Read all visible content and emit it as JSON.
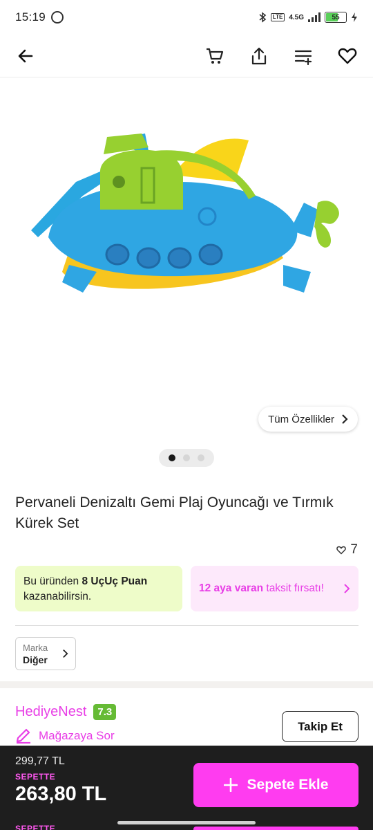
{
  "status_bar": {
    "time": "15:19",
    "network": "4.5G",
    "battery": "55",
    "icons": [
      "whatsapp-icon",
      "bluetooth-icon",
      "volte-icon",
      "signal-icon",
      "battery-icon",
      "charging-icon"
    ]
  },
  "app_bar": {
    "icons": [
      "back-arrow-icon",
      "cart-icon",
      "share-icon",
      "compare-list-icon",
      "heart-icon"
    ]
  },
  "gallery": {
    "features_label": "Tüm Özellikler",
    "page_count": 3,
    "active_page": 1
  },
  "product": {
    "title": "Pervaneli Denizaltı Gemi Plaj Oyuncağı ve Tırmık Kürek Set",
    "favorites": "7"
  },
  "promos": {
    "points": {
      "prefix": "Bu üründen ",
      "highlight": "8 UçUç Puan",
      "suffix": " kazanabilirsin."
    },
    "installment": {
      "highlight": "12 aya varan",
      "suffix": " taksit fırsatı!"
    }
  },
  "brand": {
    "label": "Marka",
    "value": "Diğer"
  },
  "store": {
    "name": "HediyeNest",
    "rating": "7.3",
    "ask_label": "Mağazaya Sor",
    "follow_label": "Takip Et"
  },
  "purchase": {
    "old_price": "299,77 TL",
    "basket_label": "SEPETTE",
    "price": "263,80 TL",
    "add_label": "Sepete Ekle",
    "peek_label": "SEPETTE"
  },
  "colors": {
    "accent": "#ff3cf0",
    "brand_pink": "#e83ee6",
    "rating_green": "#66bb35",
    "points_bg": "#eefcc9",
    "installment_bg": "#fde9fb",
    "bottom_bar": "#1e1e1e"
  }
}
